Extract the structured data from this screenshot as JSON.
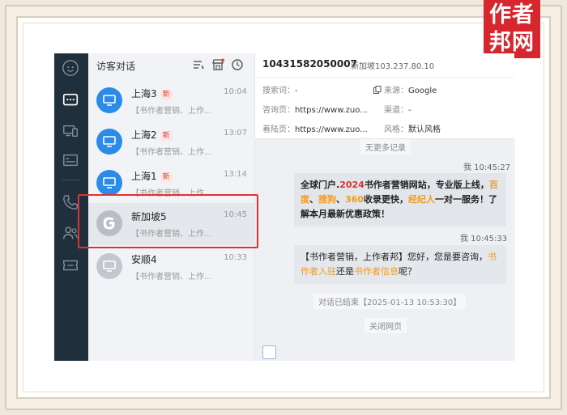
{
  "logo": {
    "line1": "作者",
    "line2": "邦网"
  },
  "list": {
    "title": "访客对话",
    "items": [
      {
        "name": "上海3",
        "badge": "新",
        "time": "10:04",
        "snippet": "【书作者营销、上作..."
      },
      {
        "name": "上海2",
        "badge": "新",
        "time": "13:07",
        "snippet": "【书作者营销、上作..."
      },
      {
        "name": "上海1",
        "badge": "新",
        "time": "13:14",
        "snippet": "【书作者营销、上作..."
      },
      {
        "name": "新加坡5",
        "badge": "",
        "time": "10:45",
        "snippet": "【书作者营销、上作..."
      },
      {
        "name": "安顺4",
        "badge": "",
        "time": "10:33",
        "snippet": "【书作者营销、上作..."
      }
    ]
  },
  "conversation": {
    "visitor_id": "10431582050007",
    "location": "新加坡103.237.80.10",
    "search_label": "搜索词：",
    "search_value": "-",
    "source_label": "来源：",
    "source_value": "Google",
    "consult_label": "咨询页：",
    "consult_value": "https://www.zuo...",
    "channel_label": "渠道：",
    "channel_value": "-",
    "landing_label": "着陆页：",
    "landing_value": "https://www.zuo...",
    "style_label": "风格：",
    "style_value": "默认风格",
    "no_more": "无更多记录",
    "msg1_meta": "我 10:45:27",
    "msg1": {
      "p1": "全球门户.",
      "p2": "2024",
      "p3": "书作者营销网站，专业版上线，",
      "p4": "百度",
      "p5": "、",
      "p6": "搜狗",
      "p7": "、",
      "p8": "360",
      "p9": "收录更快，",
      "p10": "经纪人",
      "p11": "一对一服务！了解本月最新优惠政策！"
    },
    "msg2_meta": "我 10:45:33",
    "msg2": {
      "p1": "【书作者营销，上作者邦】您好，您是要咨询，",
      "p2": "书作者入驻",
      "p3": "还是",
      "p4": "书作者信息",
      "p5": "呢？"
    },
    "ended": "对话已结束【2025-01-13 10:53:30】",
    "closed": "关闭网页"
  },
  "colors": {
    "rail": "#1f2f3c",
    "accent": "#2b8be8",
    "highlight": "#e13232",
    "logo": "#d7262e"
  }
}
